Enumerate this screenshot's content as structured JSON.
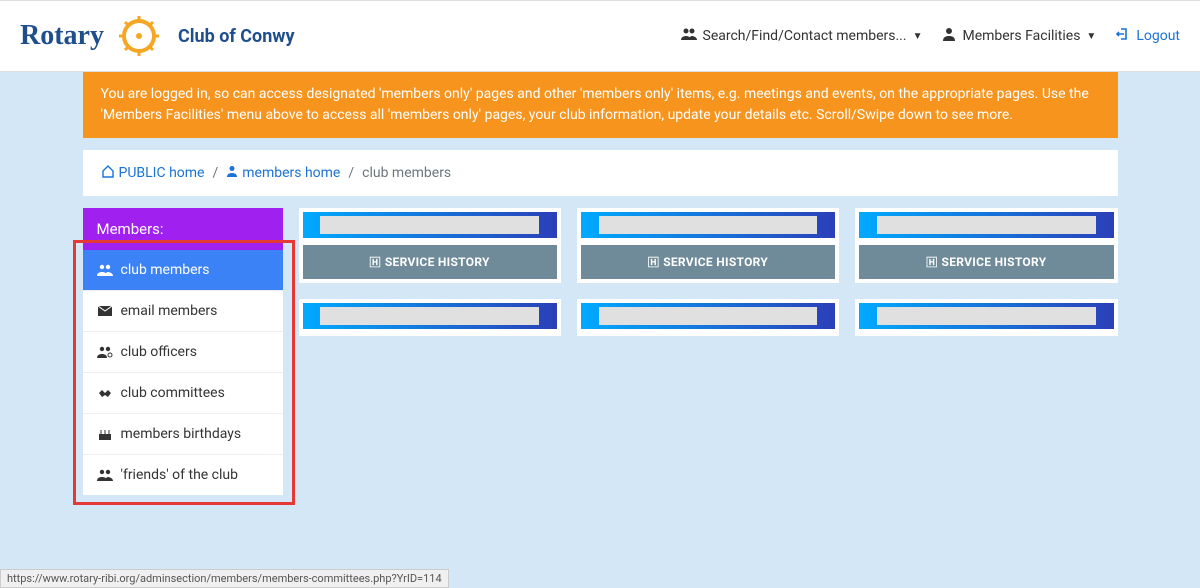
{
  "header": {
    "brand_word": "Rotary",
    "brand_sub": "Club of Conwy",
    "nav_search": "Search/Find/Contact members...",
    "nav_facilities": "Members Facilities",
    "nav_logout": "Logout"
  },
  "banner": "You are logged in, so can access designated 'members only' pages and other 'members only' items, e.g. meetings and events, on the appropriate pages. Use the 'Members Facilities' menu above to access all 'members only' pages, your club information, update your details etc. Scroll/Swipe down to see more.",
  "breadcrumb": {
    "home": "PUBLIC home",
    "members_home": "members home",
    "current": "club members"
  },
  "sidebar": {
    "header": "Members:",
    "items": [
      {
        "label": "club members",
        "icon": "users",
        "active": true
      },
      {
        "label": "email members",
        "icon": "envelope",
        "active": false
      },
      {
        "label": "club officers",
        "icon": "users-cog",
        "active": false
      },
      {
        "label": "club committees",
        "icon": "handshake",
        "active": false
      },
      {
        "label": "members birthdays",
        "icon": "birthday",
        "active": false
      },
      {
        "label": "'friends' of the club",
        "icon": "user-friends",
        "active": false
      }
    ]
  },
  "cards": {
    "service_history": "SERVICE HISTORY"
  },
  "status_url": "https://www.rotary-ribi.org/adminsection/members/members-committees.php?YrID=114"
}
